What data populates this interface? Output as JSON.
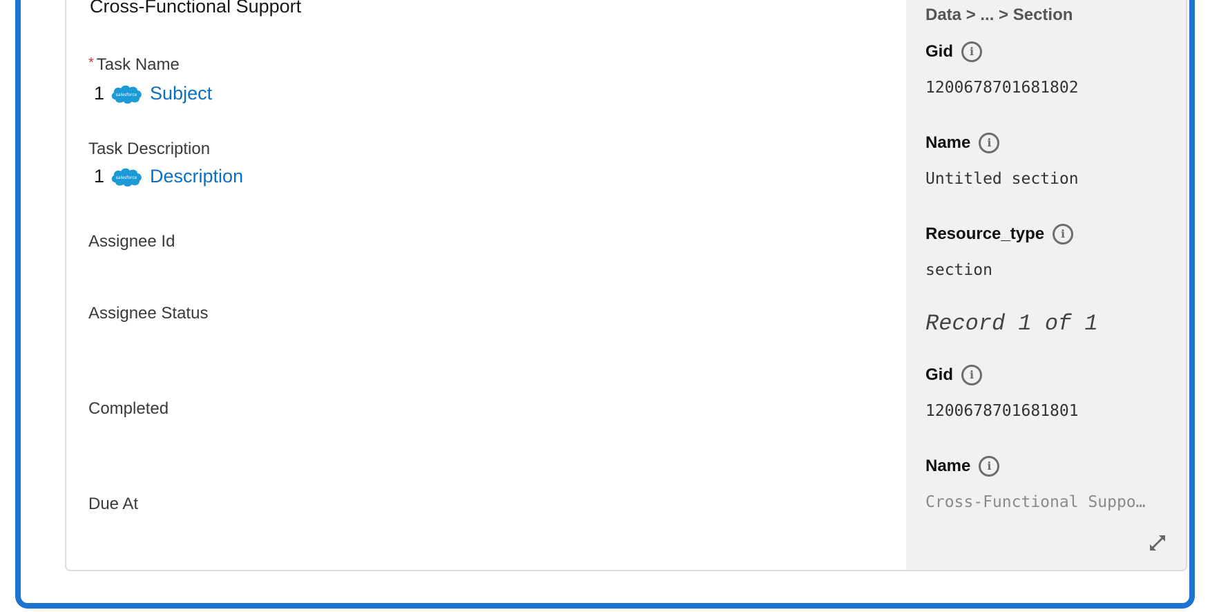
{
  "section_title": "Cross-Functional Support",
  "fields": [
    {
      "label": "Task Name",
      "required": true,
      "value": {
        "count": "1",
        "source_icon": "salesforce-icon",
        "source_label": "salesforce",
        "link": "Subject"
      }
    },
    {
      "label": "Task Description",
      "required": false,
      "value": {
        "count": "1",
        "source_icon": "salesforce-icon",
        "source_label": "salesforce",
        "link": "Description"
      }
    },
    {
      "label": "Assignee Id",
      "required": false
    },
    {
      "label": "Assignee Status",
      "required": false
    },
    {
      "label": "Completed",
      "required": false
    },
    {
      "label": "Due At",
      "required": false
    }
  ],
  "required_marker": "*",
  "panel": {
    "breadcrumb": "Data > ... > Section",
    "records": [
      {
        "fields": [
          {
            "label": "Gid",
            "value": "1200678701681802"
          },
          {
            "label": "Name",
            "value": "Untitled section"
          },
          {
            "label": "Resource_type",
            "value": "section"
          }
        ]
      },
      {
        "fields": [
          {
            "label": "Gid",
            "value": "1200678701681801"
          },
          {
            "label": "Name",
            "value": "Cross-Functional Support"
          }
        ]
      }
    ],
    "record_counter": "Record 1 of 1",
    "info_glyph": "i",
    "expand_icon": "expand-icon"
  },
  "colors": {
    "accent": "#1b74d1",
    "link": "#0b6fc1",
    "required": "#c23934",
    "panel_bg": "#f1f1f1"
  }
}
